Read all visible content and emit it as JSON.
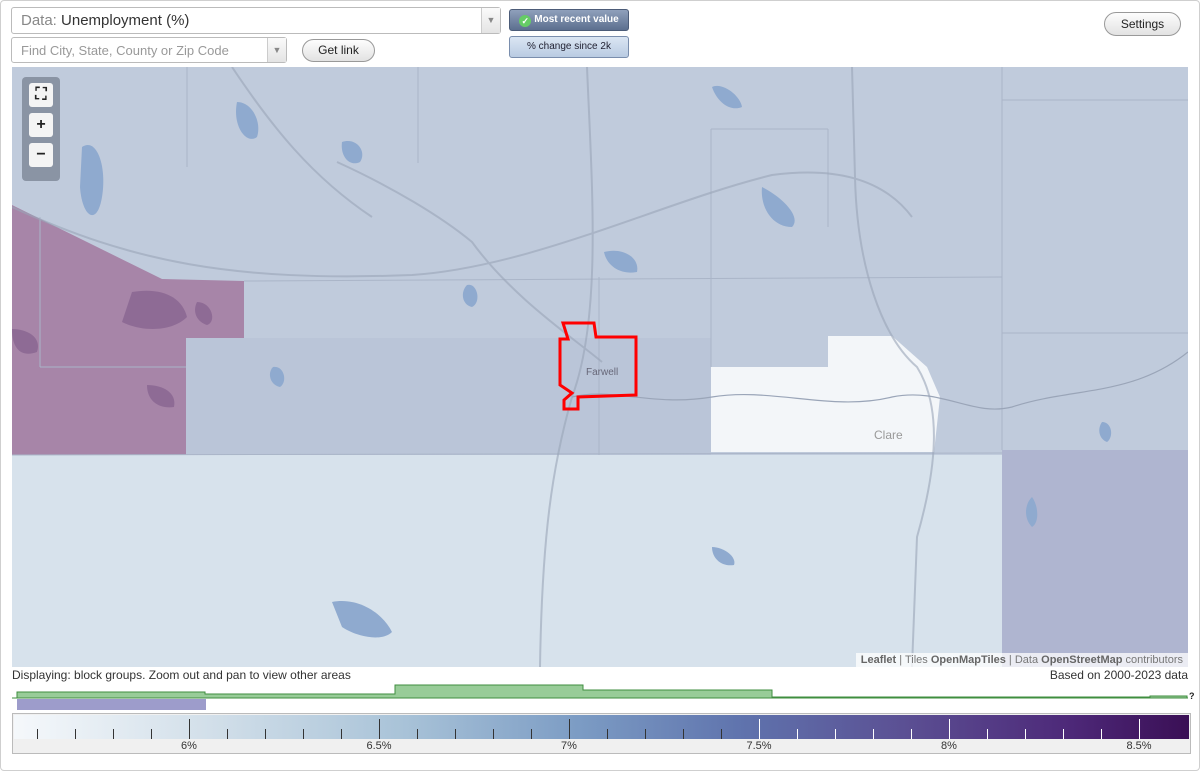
{
  "data_select": {
    "label": "Data:",
    "value": "Unemployment (%)"
  },
  "search": {
    "placeholder": "Find City, State, County or Zip Code"
  },
  "buttons": {
    "get_link": "Get link",
    "settings": "Settings"
  },
  "toggles": {
    "most_recent": "Most recent value",
    "pct_change": "% change since 2k",
    "selected": "most_recent"
  },
  "map": {
    "place_labels": {
      "farwell": "Farwell",
      "clare": "Clare"
    },
    "attribution": {
      "leaflet": "Leaflet",
      "tiles_prefix": "Tiles",
      "tiles": "OpenMapTiles",
      "data_prefix": "Data",
      "data": "OpenStreetMap",
      "data_suffix": "contributors"
    },
    "highlight_color": "#ff0000"
  },
  "footer": {
    "display_note": "Displaying: block groups. Zoom out and pan to view other areas",
    "based_on": "Based on 2000-2023 data"
  },
  "legend": {
    "tick_labels": [
      "6%",
      "6.5%",
      "7%",
      "7.5%",
      "8%",
      "8.5%"
    ],
    "histogram_marker": "?",
    "colors": {
      "low": "#f5f8fb",
      "mid": "#7c9cc4",
      "high": "#3a0f55",
      "histogram": "#98cc98",
      "selected_range": "#9d9ccb"
    }
  },
  "icons": {
    "fullscreen": "fullscreen-icon",
    "zoom_in": "plus-icon",
    "zoom_out": "minus-icon",
    "dropdown": "chevron-down-icon",
    "check": "check-icon"
  }
}
